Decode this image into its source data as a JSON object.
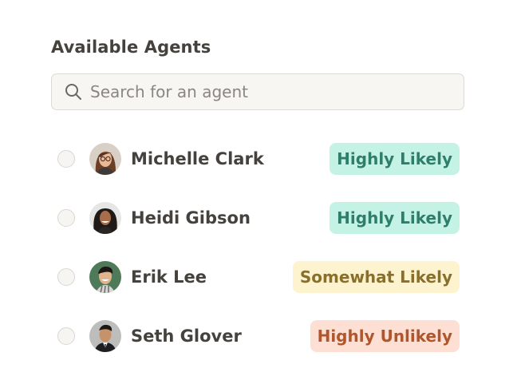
{
  "header": {
    "title": "Available Agents"
  },
  "search": {
    "placeholder": "Search for an agent",
    "value": "",
    "icon": "search-icon"
  },
  "agents": [
    {
      "name": "Michelle Clark",
      "likelihood": "Highly Likely",
      "status": "high",
      "selected": false
    },
    {
      "name": "Heidi Gibson",
      "likelihood": "Highly Likely",
      "status": "high",
      "selected": false
    },
    {
      "name": "Erik Lee",
      "likelihood": "Somewhat Likely",
      "status": "some",
      "selected": false
    },
    {
      "name": "Seth Glover",
      "likelihood": "Highly Unlikely",
      "status": "unlikely",
      "selected": false
    }
  ],
  "colors": {
    "highly_likely_bg": "#c4f3e6",
    "highly_likely_text": "#2f7e6c",
    "somewhat_likely_bg": "#fdf3cf",
    "somewhat_likely_text": "#8a6f2a",
    "highly_unlikely_bg": "#fde0d3",
    "highly_unlikely_text": "#b0562c"
  }
}
